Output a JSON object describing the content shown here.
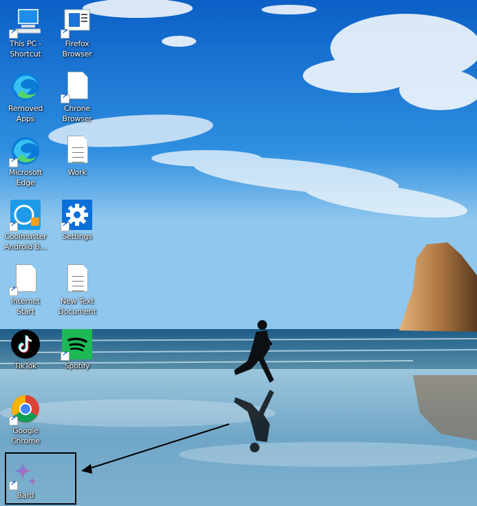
{
  "desktop": {
    "icons": [
      {
        "label": "This PC - Shortcut"
      },
      {
        "label": "Firefox Browser"
      },
      {
        "label": "Removed Apps"
      },
      {
        "label": "Chrone Browser"
      },
      {
        "label": "Microsoft Edge"
      },
      {
        "label": "Work"
      },
      {
        "label": "Coolmuster Android B..."
      },
      {
        "label": "Settings"
      },
      {
        "label": "Internet Start"
      },
      {
        "label": "New Text Document"
      },
      {
        "label": "TikTok"
      },
      {
        "label": "Spotify"
      },
      {
        "label": "Google Chrome"
      },
      {
        "label": "Bard"
      }
    ]
  },
  "colors": {
    "sky_top": "#0a62c8",
    "sky_mid": "#3a96e0",
    "sea": "#1e6f9c",
    "sand": "#8fb7c8",
    "highlight_border": "#000000"
  }
}
